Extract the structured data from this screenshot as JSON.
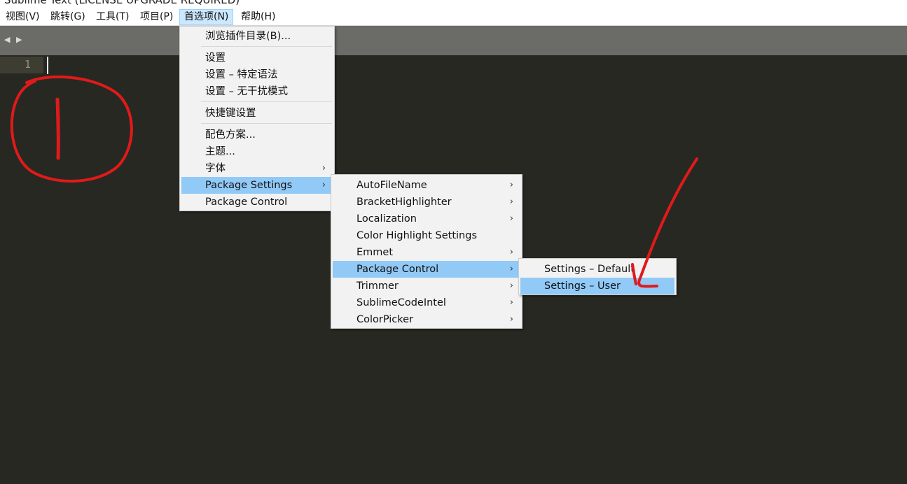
{
  "window": {
    "title": "Sublime Text (LICENSE UPGRADE REQUIRED)"
  },
  "menubar": {
    "items": [
      {
        "label": "视图(V)"
      },
      {
        "label": "跳转(G)"
      },
      {
        "label": "工具(T)"
      },
      {
        "label": "项目(P)"
      },
      {
        "label": "首选项(N)",
        "active": true
      },
      {
        "label": "帮助(H)"
      }
    ]
  },
  "tabbar": {
    "back_icon": "left-triangle-icon",
    "forward_icon": "right-triangle-icon"
  },
  "editor": {
    "line_number": "1"
  },
  "preferences_menu": {
    "items": [
      {
        "label": "浏览插件目录(B)..."
      },
      {
        "label": "设置"
      },
      {
        "label": "设置 – 特定语法"
      },
      {
        "label": "设置 – 无干扰模式"
      },
      {
        "label": "快捷键设置"
      },
      {
        "label": "配色方案..."
      },
      {
        "label": "主题..."
      },
      {
        "label": "字体",
        "submenu": true
      },
      {
        "label": "Package Settings",
        "submenu": true,
        "highlighted": true
      },
      {
        "label": "Package Control"
      }
    ]
  },
  "package_settings_menu": {
    "items": [
      {
        "label": "AutoFileName",
        "submenu": true
      },
      {
        "label": "BracketHighlighter",
        "submenu": true
      },
      {
        "label": "Localization",
        "submenu": true
      },
      {
        "label": "Color Highlight Settings"
      },
      {
        "label": "Emmet",
        "submenu": true
      },
      {
        "label": "Package Control",
        "submenu": true,
        "highlighted": true
      },
      {
        "label": "Trimmer",
        "submenu": true
      },
      {
        "label": "SublimeCodeIntel",
        "submenu": true
      },
      {
        "label": "ColorPicker",
        "submenu": true
      }
    ]
  },
  "package_control_menu": {
    "items": [
      {
        "label": "Settings – Default"
      },
      {
        "label": "Settings – User",
        "highlighted": true
      }
    ]
  },
  "submenu_arrow": "›",
  "colors": {
    "editor_bg": "#272822",
    "tabbar_bg": "#6b6b67",
    "menu_bg": "#f2f2f2",
    "menu_highlight": "#91c9f7",
    "annotation": "#e01a1a"
  }
}
